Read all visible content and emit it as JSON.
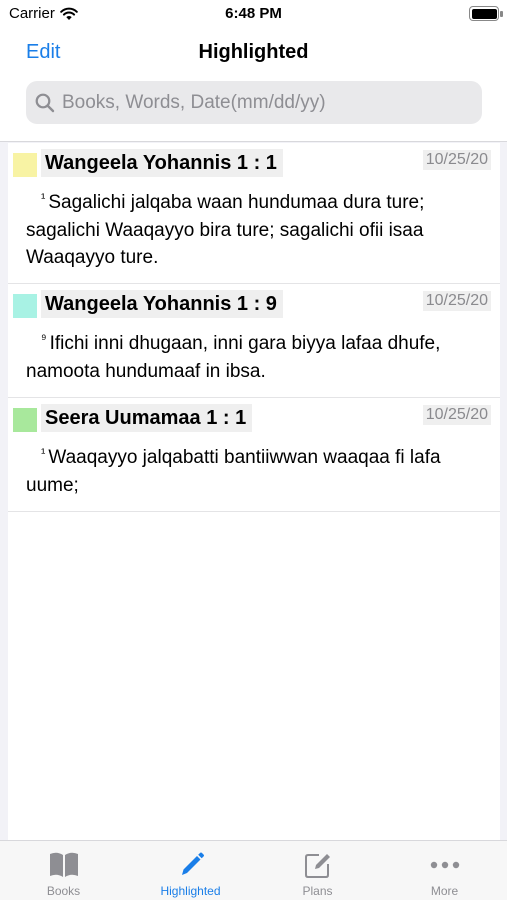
{
  "status": {
    "carrier": "Carrier",
    "time": "6:48 PM"
  },
  "nav": {
    "edit_label": "Edit",
    "title": "Highlighted"
  },
  "search": {
    "placeholder": "Books, Words, Date(mm/dd/yy)",
    "value": ""
  },
  "highlights": [
    {
      "color": "#f8f3a4",
      "ref": "Wangeela Yohannis 1 : 1",
      "date": "10/25/20",
      "verse_num": "¹",
      "text": "Sagalichi jalqaba waan hundumaa dura ture; sagalichi Waaqayyo bira ture; sagalichi ofii isaa Waaqayyo ture."
    },
    {
      "color": "#a8f2e4",
      "ref": "Wangeela Yohannis 1 : 9",
      "date": "10/25/20",
      "verse_num": "⁹",
      "text": "Ifichi inni dhugaan, inni gara biyya lafaa dhufe, namoota hundumaaf in ibsa."
    },
    {
      "color": "#a8e89c",
      "ref": "Seera Uumamaa 1 : 1",
      "date": "10/25/20",
      "verse_num": "¹",
      "text": "Waaqayyo jalqabatti bantiiwwan waaqaa fi lafa uume;"
    }
  ],
  "tabs": [
    {
      "label": "Books",
      "icon": "book-icon",
      "active": false
    },
    {
      "label": "Highlighted",
      "icon": "pencil-icon",
      "active": true
    },
    {
      "label": "Plans",
      "icon": "note-edit-icon",
      "active": false
    },
    {
      "label": "More",
      "icon": "ellipsis-icon",
      "active": false
    }
  ],
  "colors": {
    "accent": "#1a7ee8",
    "inactive_tab": "#8e8e93"
  }
}
